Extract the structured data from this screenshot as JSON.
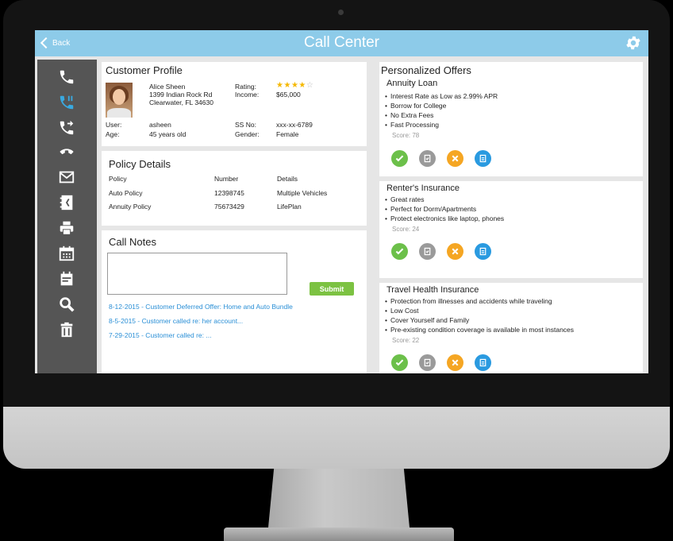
{
  "app": {
    "back_label": "Back",
    "title": "Call Center"
  },
  "sidebar": {
    "items": [
      {
        "icon": "phone-icon",
        "active": false
      },
      {
        "icon": "phone-active-icon",
        "active": true
      },
      {
        "icon": "phone-forward-icon",
        "active": false
      },
      {
        "icon": "hangup-icon",
        "active": false
      },
      {
        "icon": "mail-icon",
        "active": false
      },
      {
        "icon": "contacts-book-icon",
        "active": false
      },
      {
        "icon": "printer-icon",
        "active": false
      },
      {
        "icon": "calendar-icon",
        "active": false
      },
      {
        "icon": "calendar-day-icon",
        "active": false
      },
      {
        "icon": "search-icon",
        "active": false
      },
      {
        "icon": "trash-icon",
        "active": false
      }
    ]
  },
  "customer_profile": {
    "heading": "Customer Profile",
    "name": "Alice Sheen",
    "address1": "1399 Indian Rock Rd",
    "address2": "Clearwater, FL 34630",
    "rating_label": "Rating:",
    "rating": 4,
    "rating_max": 5,
    "income_label": "Income:",
    "income": "$65,000",
    "user_label": "User:",
    "user": "asheen",
    "age_label": "Age:",
    "age": "45 years old",
    "ssn_label": "SS No:",
    "ssn": "xxx-xx-6789",
    "gender_label": "Gender:",
    "gender": "Female"
  },
  "policy_details": {
    "heading": "Policy Details",
    "columns": [
      "Policy",
      "Number",
      "Details"
    ],
    "rows": [
      [
        "Auto Policy",
        "12398745",
        "Multiple Vehicles"
      ],
      [
        "Annuity Policy",
        "75673429",
        "LifePlan"
      ]
    ]
  },
  "call_notes": {
    "heading": "Call Notes",
    "note_value": "",
    "submit_label": "Submit",
    "history": [
      "8-12-2015 - Customer Deferred Offer: Home and Auto Bundle",
      "8-5-2015 - Customer called re: her account...",
      "7-29-2015 - Customer called re: ..."
    ]
  },
  "offers": {
    "heading": "Personalized Offers",
    "items": [
      {
        "title": "Annuity Loan",
        "bullets": [
          "Interest Rate as Low as 2.99% APR",
          "Borrow for College",
          "No Extra Fees",
          "Fast Processing"
        ],
        "score": "Score: 78"
      },
      {
        "title": "Renter's Insurance",
        "bullets": [
          "Great rates",
          "Perfect for Dorm/Apartments",
          "Protect electronics like laptop, phones"
        ],
        "score": "Score: 24"
      },
      {
        "title": "Travel Health Insurance",
        "bullets": [
          "Protection from illnesses and accidents while traveling",
          "Low Cost",
          "Cover Yourself and Family",
          "Pre-existing condition coverage is available in most instances"
        ],
        "score": "Score: 22"
      }
    ],
    "action_colors": {
      "accept": "#6cc04a",
      "review": "#9a9a9a",
      "decline": "#f5a623",
      "document": "#2a9ae0"
    }
  },
  "colors": {
    "topbar": "#8dcbe9",
    "sidebar": "#555555",
    "sidebar_icon": "#ffffff",
    "sidebar_icon_active": "#39a9e0",
    "link": "#2a8fd6",
    "submit": "#7cc242"
  }
}
